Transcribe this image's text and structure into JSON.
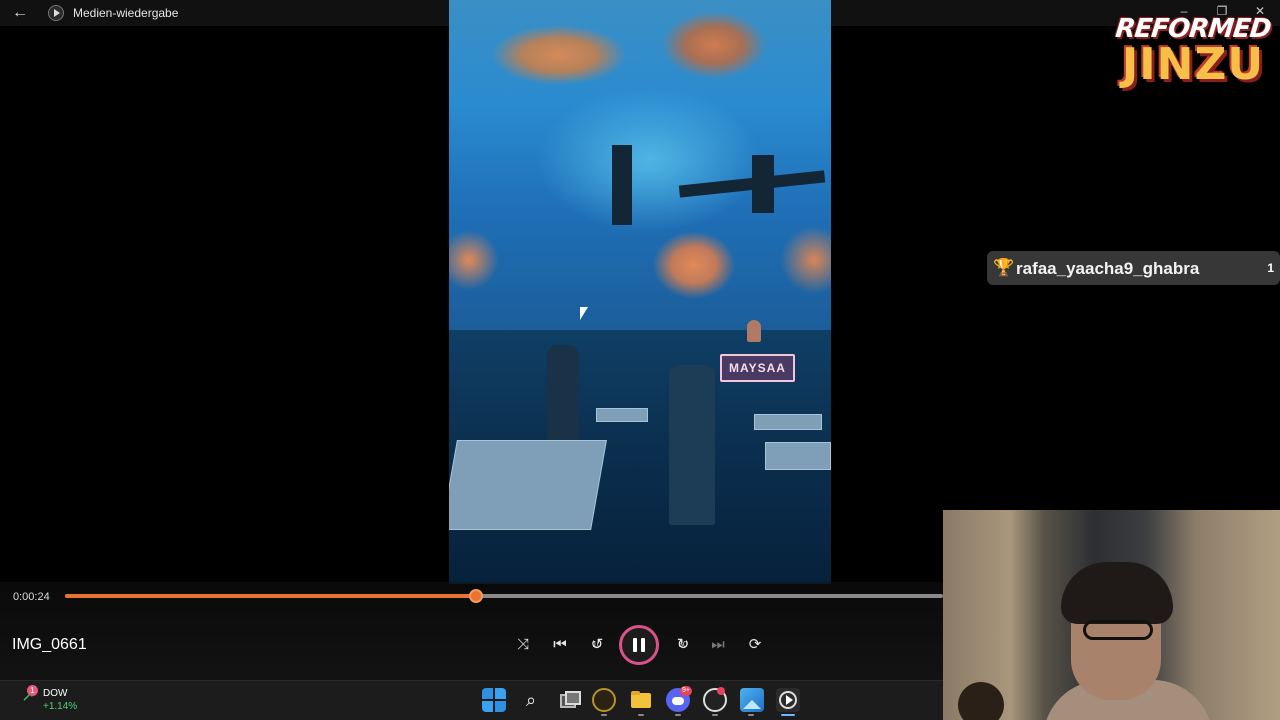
{
  "window": {
    "title": "Medien-wiedergabe",
    "back_icon": "arrow-left-icon",
    "app_icon": "media-player-icon",
    "controls": {
      "minimize": "–",
      "restore": "❐",
      "close": "✕"
    }
  },
  "video": {
    "booth_sign": "MAYSAA"
  },
  "overlay": {
    "logo_line1": "REFORMED",
    "logo_line2": "JINZU",
    "leader": {
      "icon": "trophy-icon",
      "name": "rafaa_yaacha9_ghabra",
      "count": "1"
    }
  },
  "player": {
    "elapsed": "0:00:24",
    "progress_fraction": 0.468,
    "file_name": "IMG_0661",
    "controls": {
      "shuffle": "⤨",
      "previous": "⏮",
      "rewind": "↺",
      "rewind_seconds": "10",
      "play_pause": "pause",
      "forward": "↻",
      "forward_seconds": "30",
      "next": "⏭",
      "repeat": "⟳"
    },
    "colors": {
      "accent": "#e8742d",
      "ring": "#d9538a"
    }
  },
  "taskbar": {
    "widget": {
      "name": "DOW",
      "change": "+1.14%",
      "badge": "1"
    },
    "search_icon": "⌕",
    "discord_badge": "9+"
  }
}
